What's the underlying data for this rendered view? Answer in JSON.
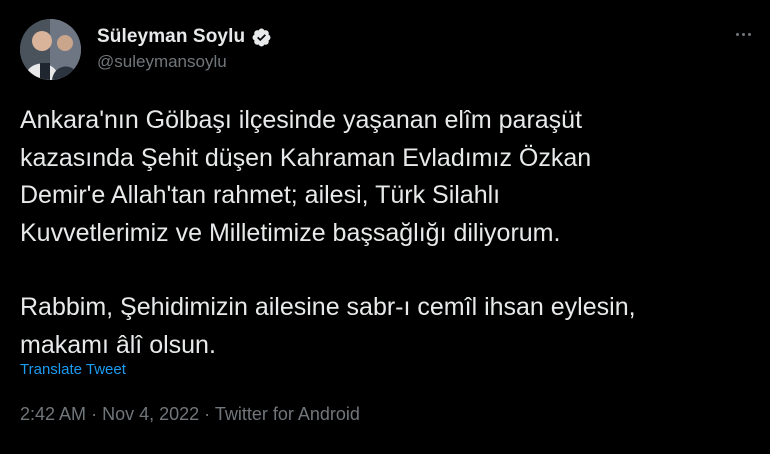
{
  "author": {
    "display_name": "Süleyman Soylu",
    "handle": "@suleymansoylu",
    "verified": true
  },
  "tweet": {
    "paragraph1_lines": [
      "Ankara'nın Gölbaşı ilçesinde yaşanan elîm paraşüt",
      "kazasında Şehit düşen Kahraman Evladımız Özkan",
      "Demir'e Allah'tan rahmet; ailesi, Türk Silahlı",
      "Kuvvetlerimiz ve Milletimize başsağlığı diliyorum."
    ],
    "paragraph2_lines": [
      "Rabbim, Şehidimizin ailesine sabr-ı cemîl ihsan eylesin,",
      "makamı âlî olsun."
    ],
    "translate_label": "Translate Tweet",
    "time": "2:42 AM",
    "separator": "·",
    "date": "Nov 4, 2022",
    "source": "Twitter for Android"
  },
  "icons": {
    "verified": "verified-badge-icon",
    "more": "more-options-icon"
  },
  "colors": {
    "background": "#000000",
    "text": "#e7e9ea",
    "secondary": "#71767b",
    "link": "#1d9bf0"
  }
}
